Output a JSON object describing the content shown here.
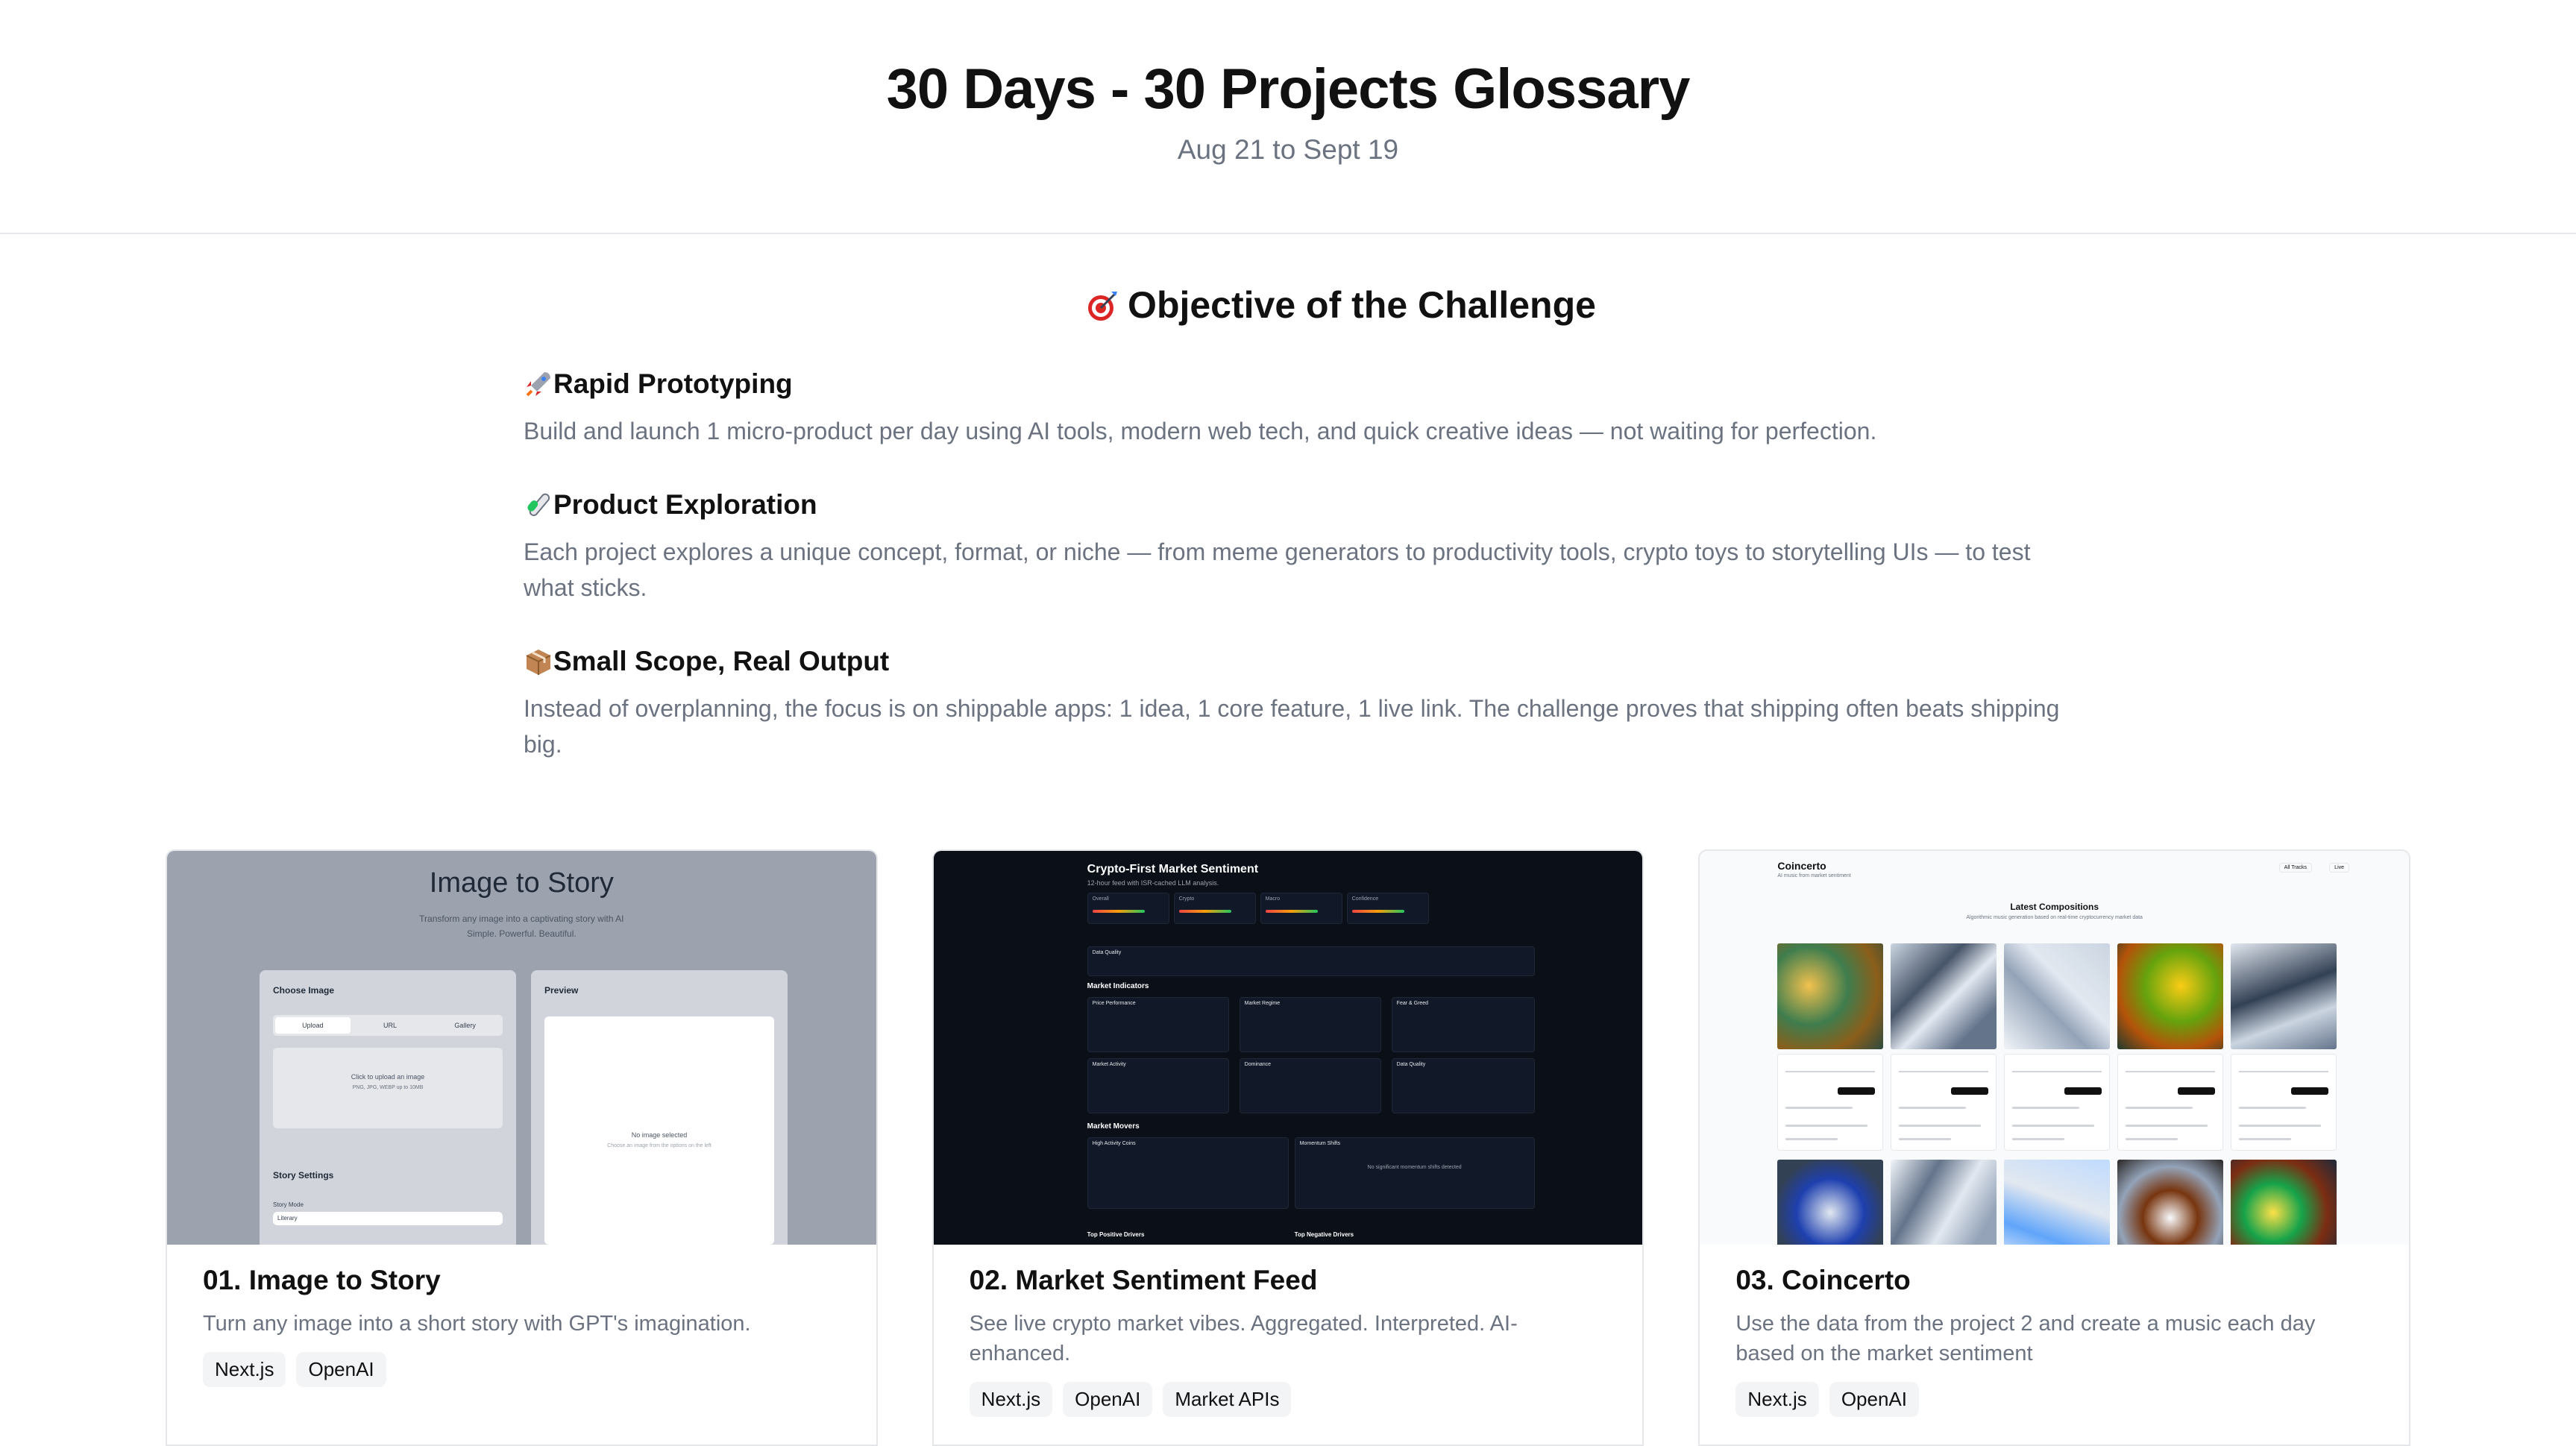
{
  "header": {
    "title": "30 Days - 30 Projects Glossary",
    "subtitle": "Aug 21 to Sept 19"
  },
  "objective": {
    "title": "Objective of the Challenge",
    "title_icon": "dart-icon",
    "items": [
      {
        "icon": "rocket-icon",
        "title": "Rapid Prototyping",
        "description": "Build and launch 1 micro-product per day using AI tools, modern web tech, and quick creative ideas — not waiting for perfection."
      },
      {
        "icon": "test-tube-icon",
        "title": "Product Exploration",
        "description": "Each project explores a unique concept, format, or niche — from meme generators to productivity tools, crypto toys to storytelling UIs — to test what sticks."
      },
      {
        "icon": "package-icon",
        "title": "Small Scope, Real Output",
        "description": "Instead of overplanning, the focus is on shippable apps: 1 idea, 1 core feature, 1 live link. The challenge proves that shipping often beats shipping big."
      }
    ]
  },
  "projects": [
    {
      "title": "01. Image to Story",
      "description": "Turn any image into a short story with GPT's imagination.",
      "tags": [
        "Next.js",
        "OpenAI"
      ],
      "thumb": {
        "title": "Image to Story",
        "subtitle": "Transform any image into a captivating story with AI",
        "tagline": "Simple. Powerful. Beautiful.",
        "choose_image": "Choose Image",
        "tabs": [
          "Upload",
          "URL",
          "Gallery"
        ],
        "upload_hint": "Click to upload an image",
        "upload_formats": "PNG, JPG, WEBP up to 10MB",
        "preview": "Preview",
        "no_image": "No image selected",
        "no_image_hint": "Choose an image from the options on the left",
        "story_settings": "Story Settings",
        "story_mode": "Story Mode",
        "story_mode_value": "Literary"
      }
    },
    {
      "title": "02. Market Sentiment Feed",
      "description": "See live crypto market vibes. Aggregated. Interpreted. AI-enhanced.",
      "tags": [
        "Next.js",
        "OpenAI",
        "Market APIs"
      ],
      "thumb": {
        "title": "Crypto-First Market Sentiment",
        "subtitle": "12-hour feed with ISR-cached LLM analysis.",
        "cards": [
          "Overall",
          "Crypto",
          "Macro",
          "Confidence"
        ],
        "sections": [
          "Data Quality",
          "Market Indicators",
          "Market Movers",
          "Top Positive Drivers",
          "Top Negative Drivers"
        ],
        "boxes": [
          "Price Performance",
          "Market Regime",
          "Fear & Greed",
          "Market Activity",
          "Dominance",
          "Data Quality",
          "High Activity Coins",
          "Momentum Shifts"
        ],
        "no_shifts": "No significant momentum shifts detected"
      }
    },
    {
      "title": "03. Coincerto",
      "description": "Use the data from the project 2 and create a music each day based on the market sentiment",
      "tags": [
        "Next.js",
        "OpenAI"
      ],
      "thumb": {
        "brand": "Coincerto",
        "brand_sub": "AI music from market sentiment",
        "heading": "Latest Compositions",
        "sub": "Algorithmic music generation based on real-time cryptocurrency market data",
        "nav": [
          "All Tracks",
          "Live"
        ]
      }
    }
  ]
}
